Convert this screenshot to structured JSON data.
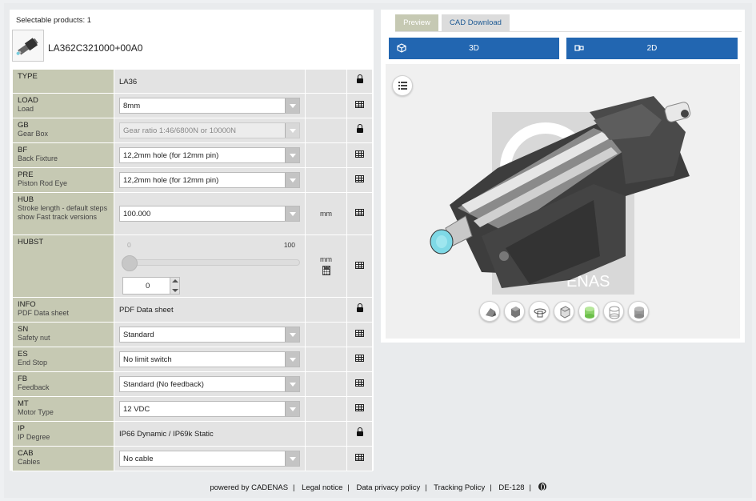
{
  "header": {
    "selectable": "Selectable products: 1",
    "product_name": "LA362C321000+00A0"
  },
  "rows": [
    {
      "key": "TYPE",
      "sub": "",
      "kind": "text",
      "value": "LA36",
      "unit": "",
      "icon": "lock-icon"
    },
    {
      "key": "LOAD",
      "sub": "Load",
      "kind": "select",
      "value": "8mm",
      "unit": "",
      "icon": "table-icon"
    },
    {
      "key": "GB",
      "sub": "Gear Box",
      "kind": "select-disabled",
      "value": "Gear ratio 1:46/6800N or 10000N",
      "unit": "",
      "icon": "lock-icon"
    },
    {
      "key": "BF",
      "sub": "Back Fixture",
      "kind": "select",
      "value": "12,2mm hole (for 12mm pin)",
      "unit": "",
      "icon": "table-icon"
    },
    {
      "key": "PRE",
      "sub": "Piston Rod Eye",
      "kind": "select",
      "value": "12,2mm hole (for 12mm pin)",
      "unit": "",
      "icon": "table-icon"
    },
    {
      "key": "HUB",
      "sub": "Stroke length - default steps show Fast track versions",
      "kind": "select",
      "value": "100.000",
      "unit": "mm",
      "icon": "table-icon"
    },
    {
      "key": "HUBST",
      "sub": "",
      "kind": "slider",
      "slider_min": "0",
      "slider_max": "100",
      "slider_value_fraction": 0.0,
      "value": "0",
      "unit": "mm",
      "icon": "table-icon"
    },
    {
      "key": "INFO",
      "sub": "PDF Data sheet",
      "kind": "text",
      "value": "PDF Data sheet",
      "unit": "",
      "icon": "lock-icon"
    },
    {
      "key": "SN",
      "sub": "Safety nut",
      "kind": "select",
      "value": "Standard",
      "unit": "",
      "icon": "table-icon"
    },
    {
      "key": "ES",
      "sub": "End Stop",
      "kind": "select",
      "value": "No limit switch",
      "unit": "",
      "icon": "table-icon"
    },
    {
      "key": "FB",
      "sub": "Feedback",
      "kind": "select",
      "value": "Standard (No feedback)",
      "unit": "",
      "icon": "table-icon"
    },
    {
      "key": "MT",
      "sub": "Motor Type",
      "kind": "select",
      "value": "12 VDC",
      "unit": "",
      "icon": "table-icon"
    },
    {
      "key": "IP",
      "sub": "IP Degree",
      "kind": "text",
      "value": "IP66 Dynamic / IP69k Static",
      "unit": "",
      "icon": "lock-icon"
    },
    {
      "key": "CAB",
      "sub": "Cables",
      "kind": "select",
      "value": "No cable",
      "unit": "",
      "icon": "table-icon"
    }
  ],
  "preview": {
    "tabs": [
      "Preview",
      "CAD Download"
    ],
    "active_tab": "Preview",
    "btn_3d": "3D",
    "btn_2d": "2D",
    "watermark": "ENAS",
    "tools": [
      "render-mode-icon",
      "cube-shaded-icon",
      "rotate-icon",
      "cube-icon",
      "cylinder-green-icon",
      "cylinder-wire-icon",
      "cylinder-gray-icon"
    ]
  },
  "footer": {
    "powered": "powered by CADENAS",
    "legal": "Legal notice",
    "privacy": "Data privacy policy",
    "tracking": "Tracking Policy",
    "lang": "DE-128"
  },
  "colors": {
    "accent_blue": "#2266b1",
    "label_cell": "#c6c9b3",
    "value_cell": "#e3e3e3"
  }
}
